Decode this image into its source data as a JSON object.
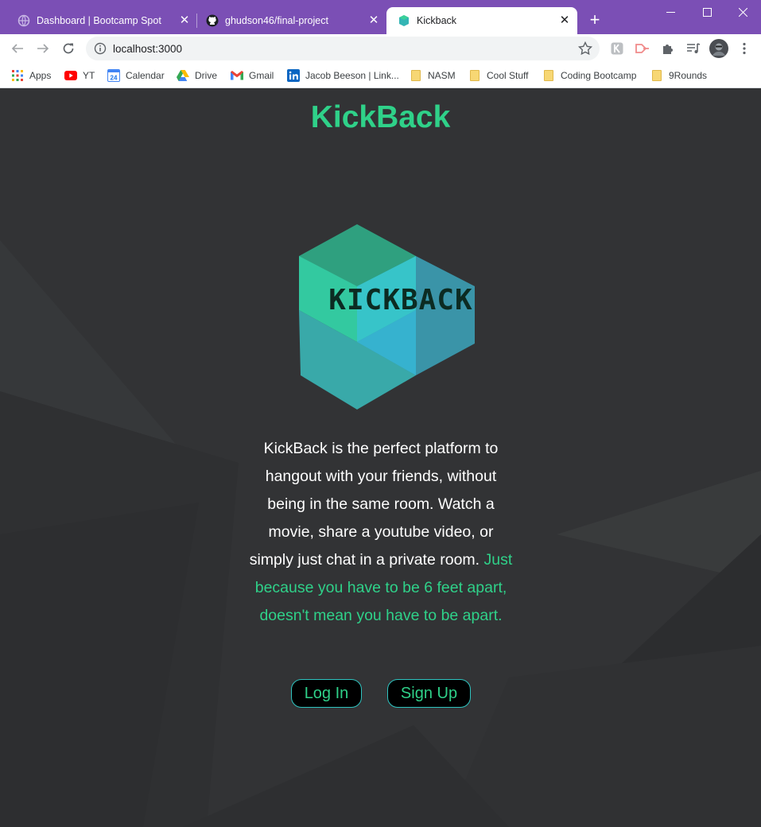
{
  "browser": {
    "tabs": [
      {
        "title": "Dashboard | Bootcamp Spot",
        "icon": "globe-icon"
      },
      {
        "title": "ghudson46/final-project",
        "icon": "github-icon"
      },
      {
        "title": "Kickback",
        "icon": "kickback-favicon",
        "active": true
      }
    ],
    "url": "localhost:3000",
    "bookmarks": [
      {
        "label": "Apps",
        "icon": "apps-grid-icon"
      },
      {
        "label": "YT",
        "icon": "youtube-icon"
      },
      {
        "label": "Calendar",
        "icon": "calendar-icon"
      },
      {
        "label": "Drive",
        "icon": "drive-icon"
      },
      {
        "label": "Gmail",
        "icon": "gmail-icon"
      },
      {
        "label": "Jacob Beeson | Link...",
        "icon": "linkedin-icon"
      },
      {
        "label": "NASM",
        "icon": "folder-icon"
      },
      {
        "label": "Cool Stuff",
        "icon": "folder-icon"
      },
      {
        "label": "Coding Bootcamp",
        "icon": "folder-icon"
      },
      {
        "label": "9Rounds",
        "icon": "folder-icon"
      }
    ],
    "calendar_day": "24"
  },
  "page": {
    "brand": "KickBack",
    "logo_text": "KICKBACK",
    "blurb_white": "KickBack is the perfect platform to hangout with your friends, without being in the same room. Watch a movie, share a youtube video, or simply just chat in a private room.",
    "blurb_green": "Just because you have to be 6 feet apart, doesn't mean you have to be apart.",
    "login_label": "Log In",
    "signup_label": "Sign Up"
  },
  "colors": {
    "accent_green": "#2fd189",
    "tabbar_purple": "#7b4fb5",
    "page_background": "#323335",
    "button_border": "#2fc4c0"
  }
}
